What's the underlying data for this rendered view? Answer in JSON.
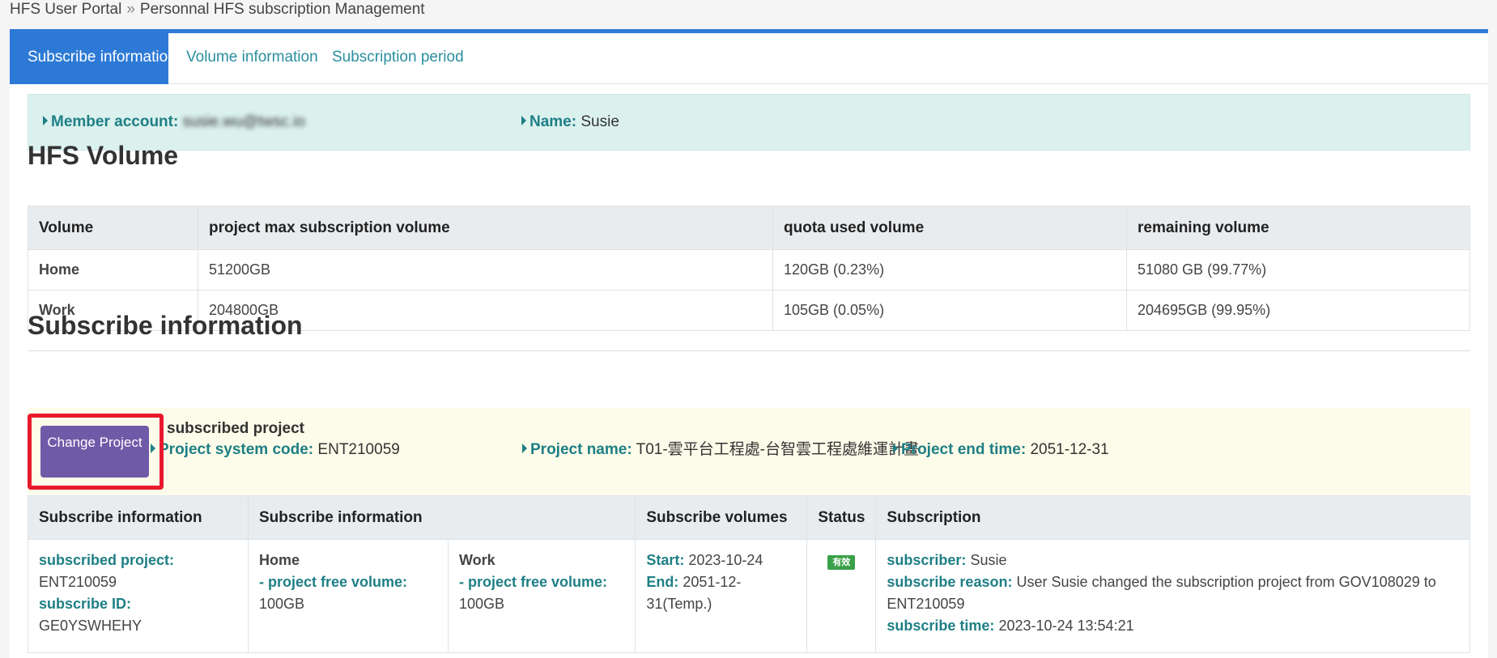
{
  "breadcrumb": {
    "root": "HFS User Portal",
    "separator": "»",
    "current": "Personnal HFS subscription Management"
  },
  "tabs": [
    "Subscribe information",
    "Volume information",
    "Subscription period"
  ],
  "member": {
    "account_label": "Member account:",
    "account_value": "susie.wu@twsc.io",
    "name_label": "Name:",
    "name_value": "Susie"
  },
  "hfs_volume": {
    "title": "HFS Volume",
    "headers": [
      "Volume",
      "project max subscription volume",
      "quota used volume",
      "remaining volume"
    ],
    "rows": [
      [
        "Home",
        "51200GB",
        "120GB (0.23%)",
        "51080 GB (99.77%)"
      ],
      [
        "Work",
        "204800GB",
        "105GB (0.05%)",
        "204695GB (99.95%)"
      ]
    ]
  },
  "subscribe": {
    "title": "Subscribe information",
    "change_button": "Change Project",
    "subscribed_project_title": "subscribed project",
    "system_code_label": "Project system code:",
    "system_code_value": "ENT210059",
    "project_name_label": "Project name:",
    "project_name_value": "T01-雲平台工程處-台智雲工程處維運計畫",
    "end_time_label": "Project end time:",
    "end_time_value": "2051-12-31",
    "headers": [
      "Subscribe information",
      "Subscribe information",
      "Subscribe volumes",
      "Status",
      "Subscription"
    ],
    "row": {
      "project_label": "subscribed project:",
      "project_value": "ENT210059",
      "id_label": "subscribe ID:",
      "id_value": "GE0YSWHEHY",
      "home_title": "Home",
      "home_free_label": "- project free volume:",
      "home_free_value": "100GB",
      "work_title": "Work",
      "work_free_label": "- project free volume:",
      "work_free_value": "100GB",
      "start_label": "Start:",
      "start_value": "2023-10-24",
      "end_label": "End:",
      "end_value": "2051-12-31(Temp.)",
      "status": "有效",
      "subscriber_label": "subscriber:",
      "subscriber_value": "Susie",
      "reason_label": "subscribe reason:",
      "reason_value": "User Susie changed the subscription project from GOV108029 to ENT210059",
      "time_label": "subscribe time:",
      "time_value": "2023-10-24 13:54:21"
    }
  },
  "colors": {
    "accent": "#2d7ad6",
    "teal_label": "#1e7f85",
    "button": "#6f5aa8",
    "highlight_border": "#e8192c",
    "status_green": "#3aa14a"
  }
}
